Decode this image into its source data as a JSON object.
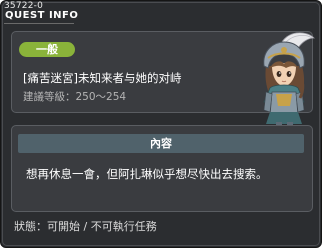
{
  "window": {
    "quest_id": "35722-0",
    "title": "QUEST INFO"
  },
  "quest": {
    "category": "一般",
    "name": "[痛苦迷宮]未知来者与她的对峙",
    "level_label": "建議等級：",
    "level_range": "250～254"
  },
  "content": {
    "header": "內容",
    "text": "想再休息一會，但阿扎琳似乎想尽快出去搜索。"
  },
  "status": {
    "label": "狀態：",
    "value": "可開始 / 不可執行任務"
  },
  "colors": {
    "window_bg": "#2b2d30",
    "panel_bg": "#3a3c40",
    "badge_bg": "#8ab33a",
    "header_bg": "#50626b"
  },
  "icons": {
    "npc": "npc-portrait-helmeted-knight"
  }
}
